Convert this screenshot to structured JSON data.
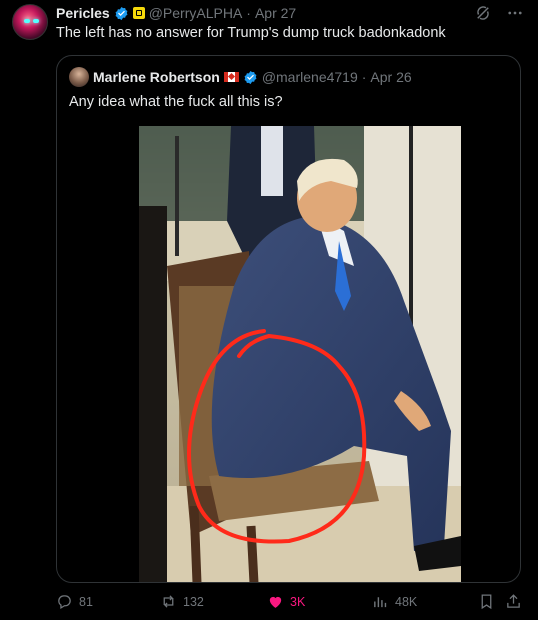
{
  "tweet": {
    "author_name": "Pericles",
    "handle": "@PerryALPHA",
    "date": "Apr 27",
    "text": "The left has no answer for Trump's dump truck badonkadonk"
  },
  "quote": {
    "author_name": "Marlene Robertson",
    "handle": "@marlene4719",
    "date": "Apr 26",
    "text": "Any idea what the fuck all this is?"
  },
  "actions": {
    "replies": "81",
    "reposts": "132",
    "likes": "3K",
    "views": "48K"
  },
  "colors": {
    "background": "#000000",
    "text": "#e7e9ea",
    "muted": "#71767b",
    "verified": "#1d9bf0",
    "like": "#f91880",
    "border": "#2f3336"
  },
  "icons": [
    "verified-icon",
    "affiliation-badge-icon",
    "grok-icon",
    "more-icon",
    "canada-flag-icon",
    "reply-icon",
    "repost-icon",
    "like-icon",
    "views-icon",
    "bookmark-icon",
    "share-icon"
  ]
}
